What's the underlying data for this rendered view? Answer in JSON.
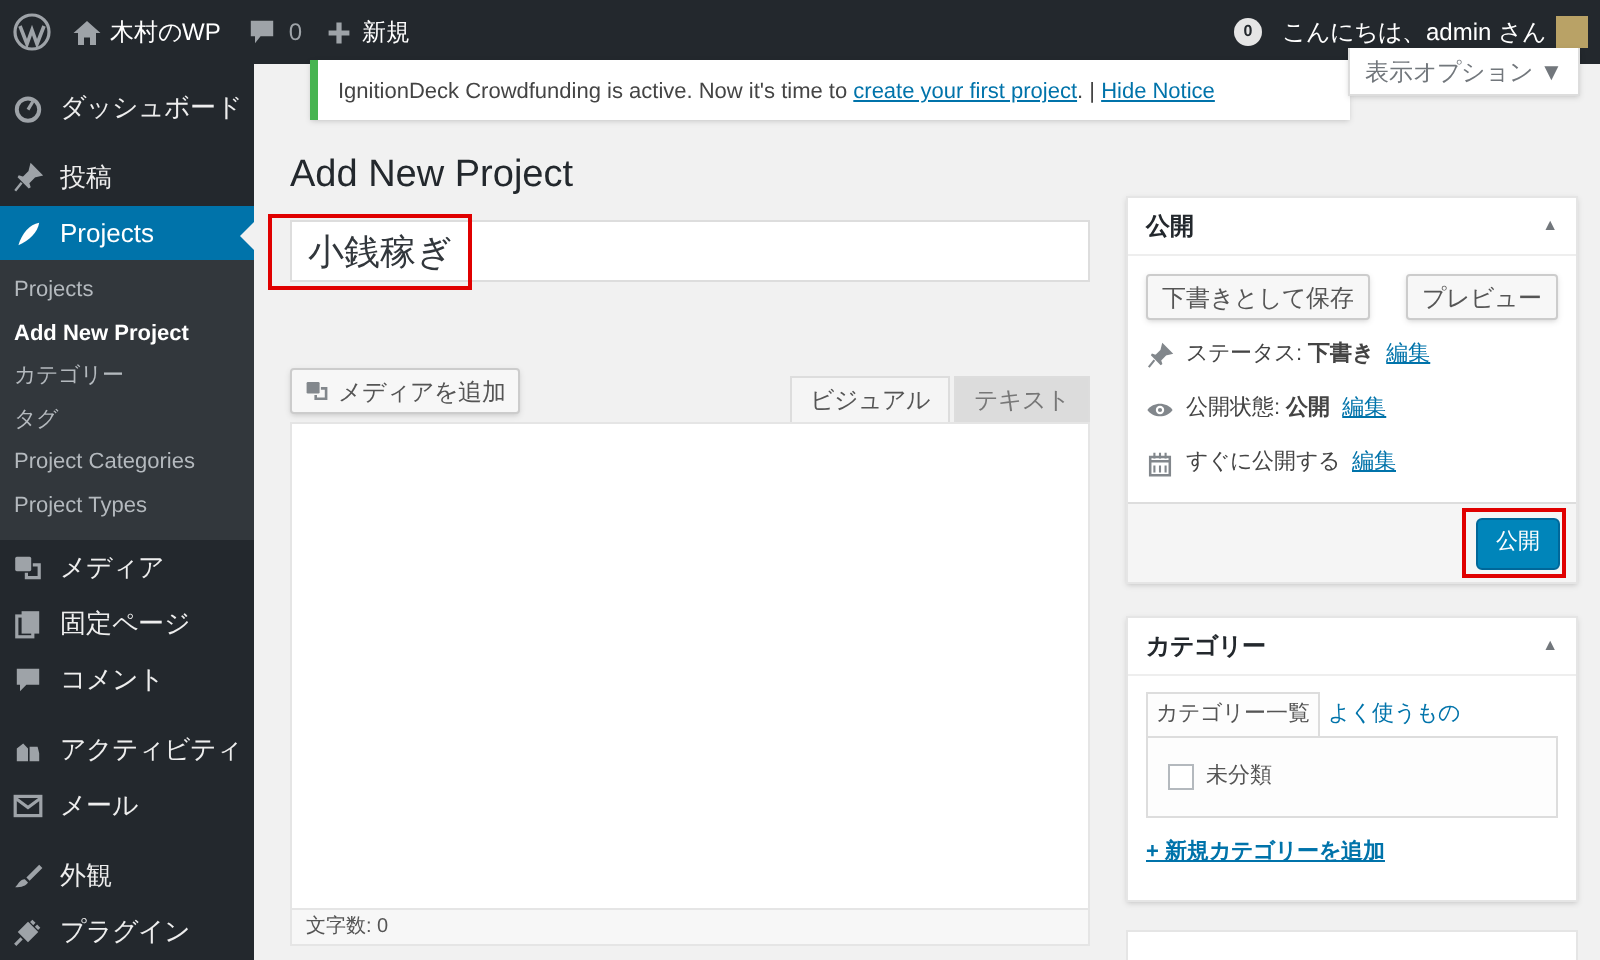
{
  "admin_bar": {
    "site_name": "木村のWP",
    "comments_count": "0",
    "new_label": "新規",
    "notifications_count": "0",
    "greeting": "こんにちは、admin さん"
  },
  "sidebar": {
    "items": [
      {
        "label": "ダッシュボード",
        "kind": "dashboard",
        "selected": false
      },
      {
        "label": "投稿",
        "kind": "pin",
        "selected": false
      },
      {
        "label": "Projects",
        "kind": "feather",
        "selected": true,
        "children": [
          {
            "label": "Projects",
            "selected": false
          },
          {
            "label": "Add New Project",
            "selected": true
          },
          {
            "label": "カテゴリー",
            "selected": false
          },
          {
            "label": "タグ",
            "selected": false
          },
          {
            "label": "Project Categories",
            "selected": false
          },
          {
            "label": "Project Types",
            "selected": false
          }
        ]
      },
      {
        "label": "メディア",
        "kind": "media",
        "selected": false
      },
      {
        "label": "固定ページ",
        "kind": "pages",
        "selected": false
      },
      {
        "label": "コメント",
        "kind": "comment",
        "selected": false
      },
      {
        "label": "アクティビティ",
        "kind": "activity",
        "selected": false
      },
      {
        "label": "メール",
        "kind": "mail",
        "selected": false
      },
      {
        "label": "外観",
        "kind": "brush",
        "selected": false
      },
      {
        "label": "プラグイン",
        "kind": "plug",
        "selected": false
      }
    ]
  },
  "notice": {
    "text": "IgnitionDeck Crowdfunding is active. Now it's time to ",
    "link": "create your first project",
    "separator": ". |",
    "hide_link": "Hide Notice"
  },
  "screen_options": "表示オプション ▼",
  "page_title": "Add New Project",
  "title_field": {
    "value": "小銭稼ぎ",
    "highlighted": true
  },
  "editor": {
    "media_button": "メディアを追加",
    "tabs": [
      {
        "label": "ビジュアル",
        "selected": true
      },
      {
        "label": "テキスト",
        "selected": false
      }
    ],
    "word_count": "文字数: 0"
  },
  "publish_box": {
    "title": "公開",
    "toggle": "▲",
    "save_draft": "下書きとして保存",
    "preview": "プレビュー",
    "rows": [
      {
        "kind": "pin",
        "label": "ステータス: ",
        "value": "下書き",
        "link": "編集"
      },
      {
        "kind": "eye",
        "label": "公開状態: ",
        "value": "公開",
        "link": "編集"
      },
      {
        "kind": "calendar",
        "label": "すぐに公開する",
        "link": "編集"
      }
    ],
    "publish_button": {
      "label": "公開",
      "highlighted": true
    }
  },
  "category_box": {
    "title": "カテゴリー",
    "toggle": "▲",
    "tabs": [
      {
        "label": "カテゴリー一覧",
        "selected": true
      },
      {
        "label": "よく使うもの",
        "selected": false
      }
    ],
    "categories": [
      {
        "label": "未分類",
        "checked": false
      }
    ],
    "add_link": "+ 新規カテゴリーを追加"
  }
}
